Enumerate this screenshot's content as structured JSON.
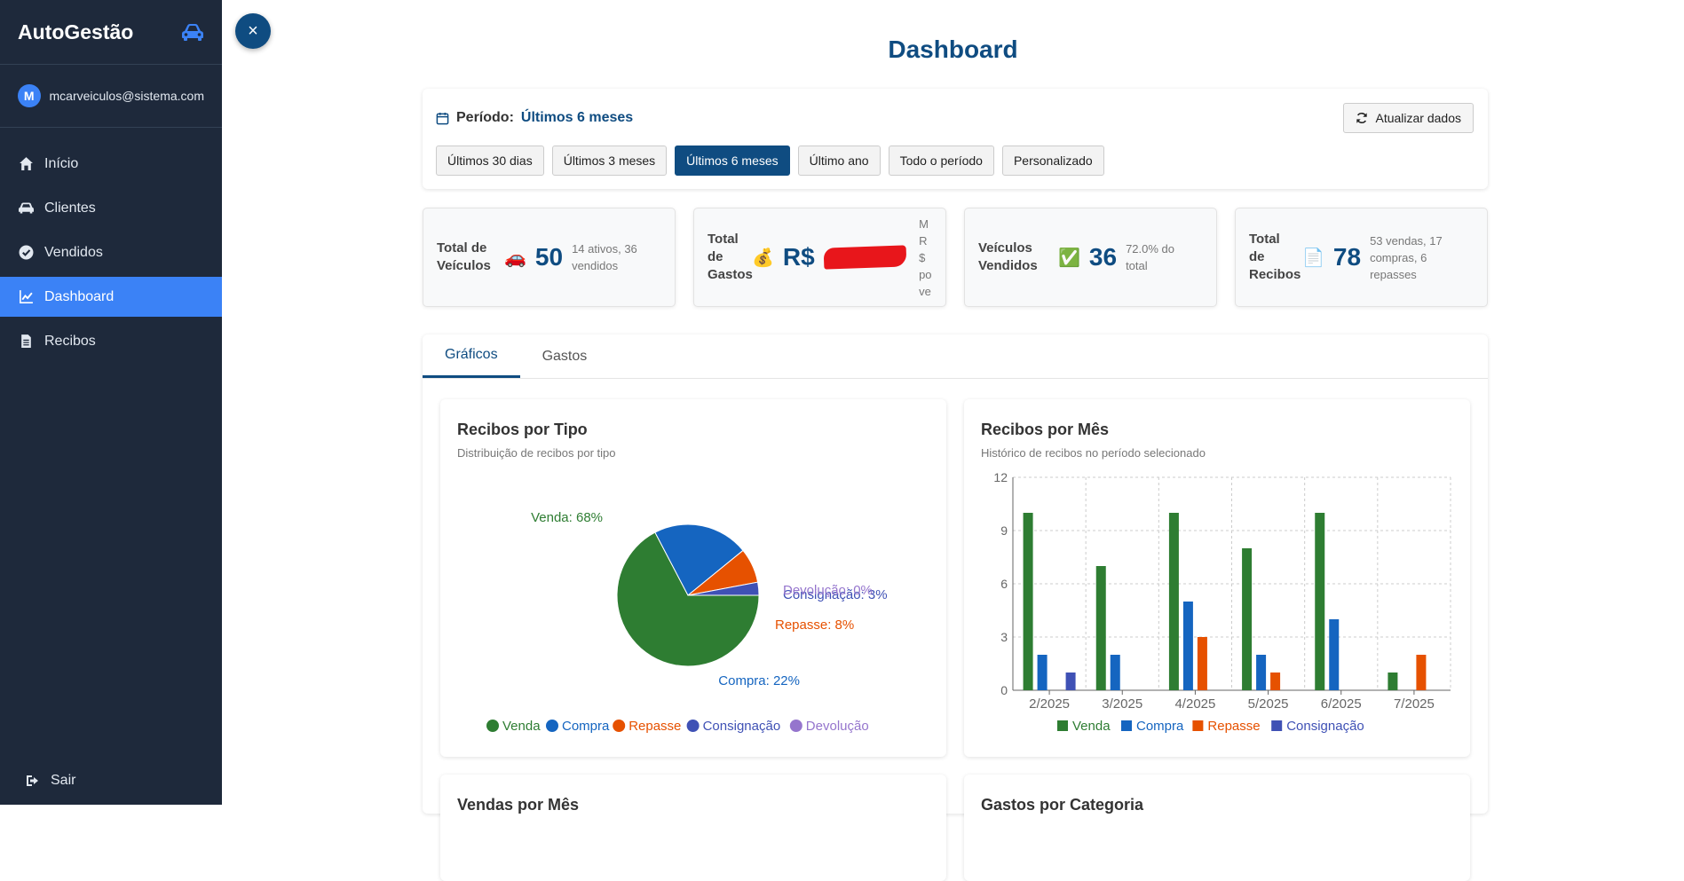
{
  "sidebar": {
    "brand": "AutoGestão",
    "avatar_letter": "M",
    "user_email": "mcarveiculos@sistema.com",
    "items": [
      {
        "label": "Início",
        "icon": "home-icon"
      },
      {
        "label": "Clientes",
        "icon": "car-icon"
      },
      {
        "label": "Vendidos",
        "icon": "check-circle-icon"
      },
      {
        "label": "Dashboard",
        "icon": "chart-line-icon"
      },
      {
        "label": "Recibos",
        "icon": "file-icon"
      }
    ],
    "active_item": "Dashboard",
    "logout_label": "Sair"
  },
  "close_glyph": "×",
  "page_title": "Dashboard",
  "period": {
    "label": "Período:",
    "value": "Últimos 6 meses",
    "refresh_label": "Atualizar dados",
    "options": [
      "Últimos 30 dias",
      "Últimos 3 meses",
      "Últimos 6 meses",
      "Último ano",
      "Todo o período",
      "Personalizado"
    ],
    "selected": "Últimos 6 meses"
  },
  "stats": {
    "vehicles": {
      "label": "Total de Veículos",
      "icon": "🚗",
      "value": "50",
      "sub": "14 ativos, 36 vendidos"
    },
    "expenses": {
      "label": "Total de Gastos",
      "icon": "💰",
      "value": "R$",
      "sub": "M R$ po ve"
    },
    "sold": {
      "label": "Veículos Vendidos",
      "icon": "✅",
      "value": "36",
      "sub": "72.0% do total"
    },
    "receipts": {
      "label": "Total de Recibos",
      "icon": "📄",
      "value": "78",
      "sub": "53 vendas, 17 compras, 6 repasses"
    }
  },
  "tabs": [
    "Gráficos",
    "Gastos"
  ],
  "active_tab": "Gráficos",
  "panels": {
    "pie": {
      "title": "Recibos por Tipo",
      "subtitle": "Distribuição de recibos por tipo"
    },
    "bar": {
      "title": "Recibos por Mês",
      "subtitle": "Histórico de recibos no período selecionado"
    },
    "sales": {
      "title": "Vendas por Mês"
    },
    "expenses": {
      "title": "Gastos por Categoria"
    }
  },
  "colors": {
    "venda": "#2e7d32",
    "compra": "#1565c0",
    "repasse": "#e65100",
    "consignacao": "#3f51b5",
    "devolucao": "#9575cd"
  },
  "chart_data": [
    {
      "type": "pie",
      "title": "Recibos por Tipo",
      "slices": [
        {
          "name": "Venda",
          "value": 68,
          "label": "Venda: 68%",
          "color": "#2e7d32"
        },
        {
          "name": "Compra",
          "value": 22,
          "label": "Compra: 22%",
          "color": "#1565c0"
        },
        {
          "name": "Repasse",
          "value": 8,
          "label": "Repasse: 8%",
          "color": "#e65100"
        },
        {
          "name": "Consignação",
          "value": 3,
          "label": "Consignação: 3%",
          "color": "#3f51b5"
        },
        {
          "name": "Devolução",
          "value": 0,
          "label": "Devolução: 0%",
          "color": "#9575cd"
        }
      ],
      "legend": [
        "Venda",
        "Compra",
        "Repasse",
        "Consignação",
        "Devolução"
      ]
    },
    {
      "type": "bar",
      "title": "Recibos por Mês",
      "categories": [
        "2/2025",
        "3/2025",
        "4/2025",
        "5/2025",
        "6/2025",
        "7/2025"
      ],
      "ylim": [
        0,
        12
      ],
      "yticks": [
        0,
        3,
        6,
        9,
        12
      ],
      "grid": true,
      "legend_position": "bottom",
      "series": [
        {
          "name": "Venda",
          "color": "#2e7d32",
          "values": [
            10,
            7,
            10,
            8,
            10,
            1
          ]
        },
        {
          "name": "Compra",
          "color": "#1565c0",
          "values": [
            2,
            2,
            5,
            2,
            4,
            0
          ]
        },
        {
          "name": "Repasse",
          "color": "#e65100",
          "values": [
            0,
            0,
            3,
            1,
            0,
            2
          ]
        },
        {
          "name": "Consignação",
          "color": "#3f51b5",
          "values": [
            1,
            0,
            0,
            0,
            0,
            0
          ]
        }
      ]
    }
  ]
}
